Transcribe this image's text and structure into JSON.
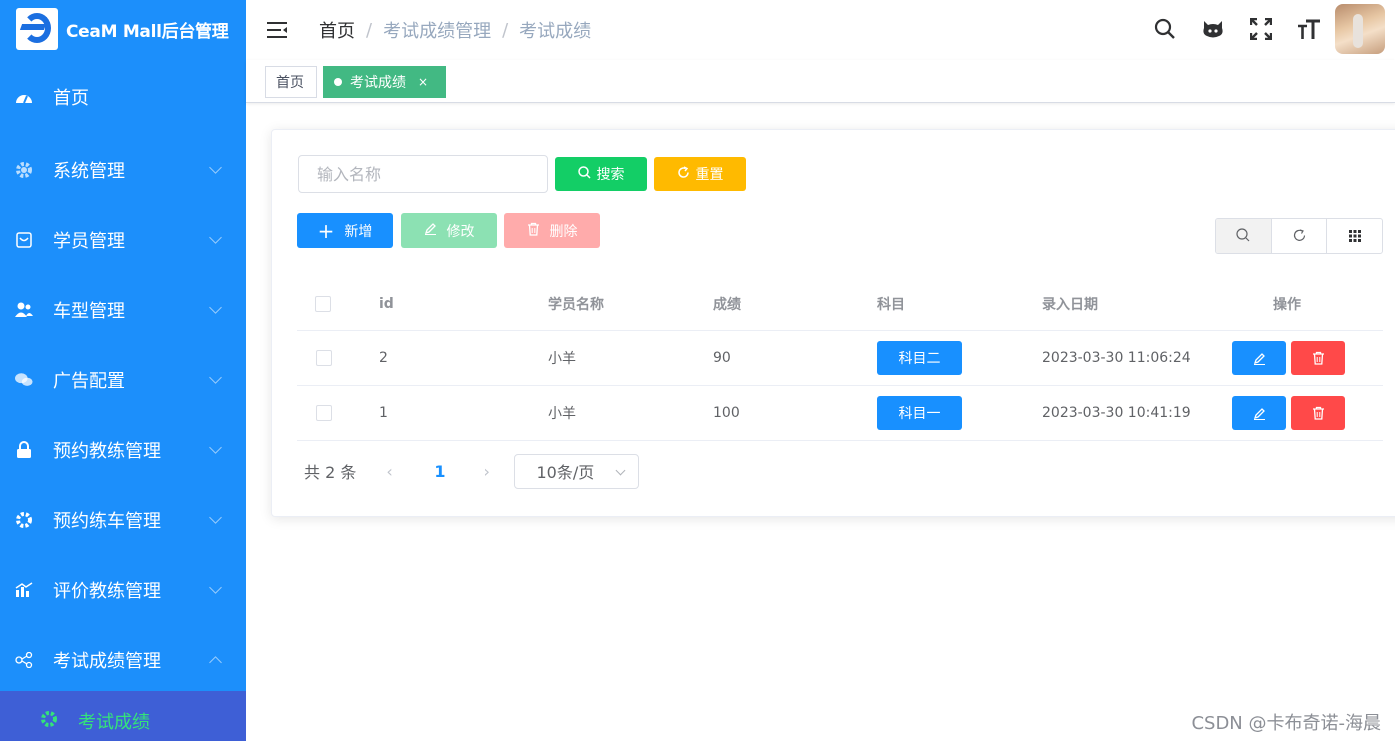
{
  "app": {
    "title": "CeaM Mall后台管理"
  },
  "sidebar": {
    "items": [
      {
        "label": "首页",
        "icon": "dashboard-icon",
        "has_children": false
      },
      {
        "label": "系统管理",
        "icon": "gear-icon",
        "has_children": true
      },
      {
        "label": "学员管理",
        "icon": "inbox-icon",
        "has_children": true
      },
      {
        "label": "车型管理",
        "icon": "users-icon",
        "has_children": true
      },
      {
        "label": "广告配置",
        "icon": "wechat-icon",
        "has_children": true
      },
      {
        "label": "预约教练管理",
        "icon": "lock-icon",
        "has_children": true
      },
      {
        "label": "预约练车管理",
        "icon": "cog-icon",
        "has_children": true
      },
      {
        "label": "评价教练管理",
        "icon": "chart-icon",
        "has_children": true
      },
      {
        "label": "考试成绩管理",
        "icon": "share-icon",
        "has_children": true,
        "expanded": true
      }
    ],
    "active_sub": {
      "label": "考试成绩",
      "icon": "gear-icon"
    }
  },
  "header": {
    "breadcrumb": [
      "首页",
      "考试成绩管理",
      "考试成绩"
    ],
    "icons": [
      "search-icon",
      "github-icon",
      "fullscreen-icon",
      "font-size-icon"
    ]
  },
  "tags": {
    "home": "首页",
    "active": "考试成绩",
    "close": "×"
  },
  "toolbar": {
    "search_placeholder": "输入名称",
    "search_label": "搜索",
    "reset_label": "重置",
    "add_label": "新增",
    "edit_label": "修改",
    "delete_label": "删除"
  },
  "table": {
    "headers": {
      "id": "id",
      "name": "学员名称",
      "score": "成绩",
      "subject": "科目",
      "date": "录入日期",
      "ops": "操作"
    },
    "rows": [
      {
        "id": "2",
        "name": "小羊",
        "score": "90",
        "subject": "科目二",
        "date": "2023-03-30 11:06:24"
      },
      {
        "id": "1",
        "name": "小羊",
        "score": "100",
        "subject": "科目一",
        "date": "2023-03-30 10:41:19"
      }
    ]
  },
  "pagination": {
    "total": "共 2 条",
    "current_page": "1",
    "page_size": "10条/页"
  },
  "watermark": "CSDN @卡布奇诺-海晨",
  "colors": {
    "sidebar": "#1c8ffb",
    "primary": "#1890ff",
    "success": "#13ce66",
    "warning": "#ffba00",
    "danger": "#ff4949",
    "tag_active": "#42b983"
  }
}
